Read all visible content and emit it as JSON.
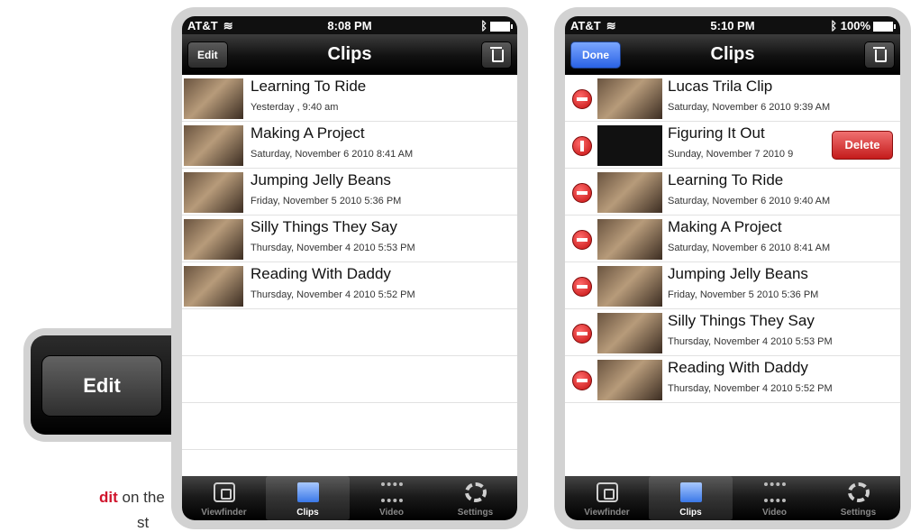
{
  "left_phone": {
    "status": {
      "carrier": "AT&T",
      "time": "8:08 PM"
    },
    "nav": {
      "edit_label": "Edit",
      "title": "Clips"
    },
    "clips": [
      {
        "name": "Learning To Ride",
        "date": "Yesterday , 9:40 am"
      },
      {
        "name": "Making A Project",
        "date": "Saturday, November 6 2010 8:41 AM"
      },
      {
        "name": "Jumping Jelly Beans",
        "date": "Friday, November 5 2010 5:36 PM"
      },
      {
        "name": "Silly Things They Say",
        "date": "Thursday, November 4 2010 5:53 PM"
      },
      {
        "name": "Reading With Daddy",
        "date": "Thursday, November 4 2010 5:52 PM"
      }
    ]
  },
  "right_phone": {
    "status": {
      "carrier": "AT&T",
      "time": "5:10 PM",
      "battery": "100%"
    },
    "nav": {
      "done_label": "Done",
      "title": "Clips"
    },
    "delete_label": "Delete",
    "clips": [
      {
        "name": "Lucas Trila Clip",
        "date": "Saturday, November 6 2010 9:39 AM"
      },
      {
        "name": "Figuring It Out",
        "date": "Sunday, November 7 2010 9"
      },
      {
        "name": "Learning To Ride",
        "date": "Saturday, November 6 2010 9:40 AM"
      },
      {
        "name": "Making A Project",
        "date": "Saturday, November 6 2010 8:41 AM"
      },
      {
        "name": "Jumping Jelly Beans",
        "date": "Friday, November 5 2010 5:36 PM"
      },
      {
        "name": "Silly Things They Say",
        "date": "Thursday, November 4 2010 5:53 PM"
      },
      {
        "name": "Reading With Daddy",
        "date": "Thursday, November 4 2010 5:52 PM"
      }
    ]
  },
  "tabs": [
    "Viewfinder",
    "Clips",
    "Video",
    "Settings"
  ],
  "active_tab": "Clips",
  "callout": {
    "label": "Edit"
  },
  "caption": {
    "bold": "dit",
    "rest": " on the",
    "line2": "st"
  },
  "icons": [
    "wifi-icon",
    "bluetooth-icon",
    "battery-icon",
    "trash-icon",
    "delete-minus-icon",
    "viewfinder-icon",
    "clips-icon",
    "video-icon",
    "settings-icon"
  ],
  "colors": {
    "accent_red": "#d0142c",
    "done_blue": "#2a62e4",
    "delete_red": "#c41b1b"
  }
}
